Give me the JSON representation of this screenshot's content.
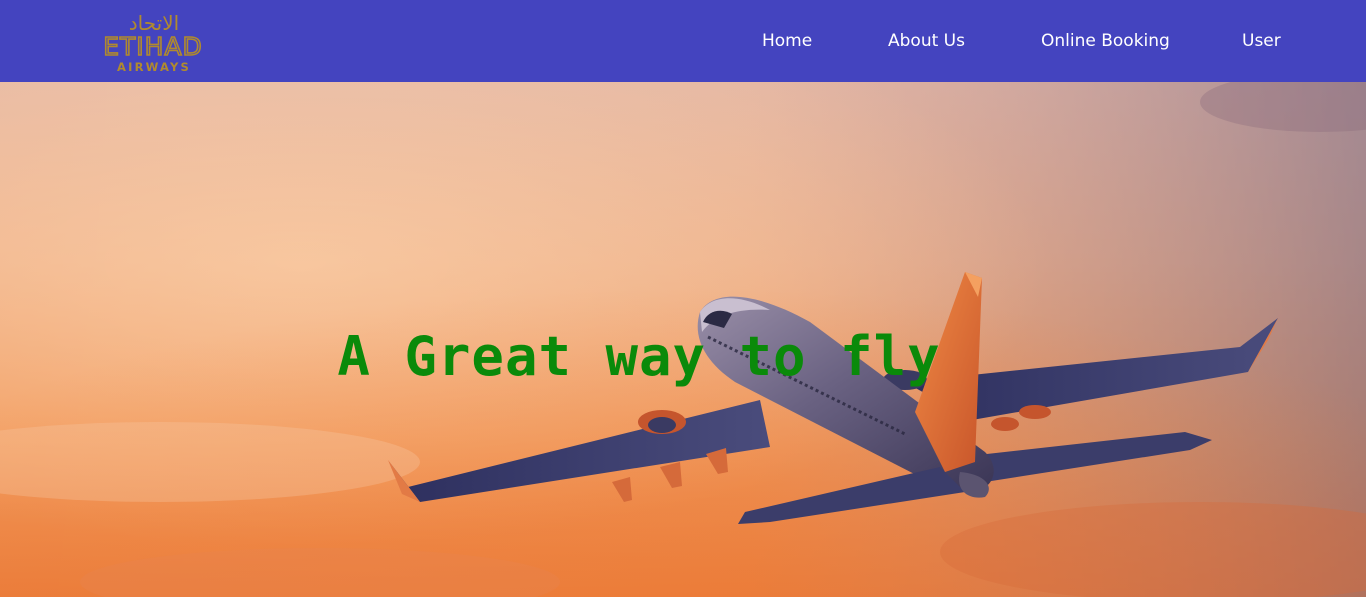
{
  "brand": {
    "arabic": "الاتحاد",
    "name": "ETIHAD",
    "sub": "AIRWAYS",
    "color": "#b08a2e"
  },
  "nav": {
    "items": [
      {
        "label": "Home"
      },
      {
        "label": "About Us"
      },
      {
        "label": "Online Booking"
      },
      {
        "label": "User"
      }
    ]
  },
  "hero": {
    "headline": "A Great way to fly",
    "headline_color": "#0a8a0a"
  },
  "theme": {
    "navbar_bg": "#4444bf",
    "nav_text": "#ffffff"
  }
}
